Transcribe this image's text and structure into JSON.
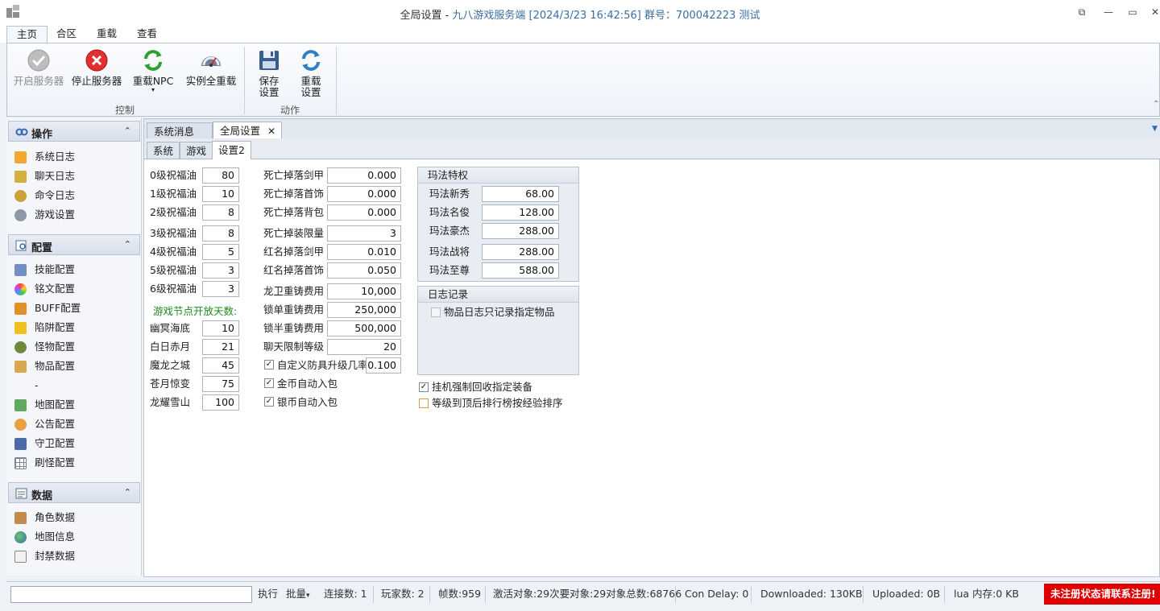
{
  "window": {
    "title_main": "全局设置 - ",
    "title_blue": "九八游戏服务端 [2024/3/23 16:42:56] 群号：700042223  测试",
    "restore_glyph": "⧉",
    "minimize_glyph": "—",
    "maximize_glyph": "▭",
    "close_glyph": "✕"
  },
  "ribbon": {
    "tabs": [
      "主页",
      "合区",
      "重载",
      "查看"
    ],
    "buttons": {
      "start_server": "开启服务器",
      "stop_server": "停止服务器",
      "reload_npc": "重载NPC",
      "reload_npc_arrow": "▾",
      "instance_reload": "实例全重载",
      "save_settings_1": "保存",
      "save_settings_2": "设置",
      "reload_settings_1": "重载",
      "reload_settings_2": "设置"
    },
    "groups": {
      "control": "控制",
      "action": "动作"
    },
    "collapse_glyph": "⌃"
  },
  "sidebar": {
    "sections": [
      {
        "title": "操作",
        "items": [
          "系统日志",
          "聊天日志",
          "命令日志",
          "游戏设置"
        ]
      },
      {
        "title": "配置",
        "items": [
          "技能配置",
          "铭文配置",
          "BUFF配置",
          "陷阱配置",
          "怪物配置",
          "物品配置",
          "-",
          "地图配置",
          "公告配置",
          "守卫配置",
          "刷怪配置"
        ]
      },
      {
        "title": "数据",
        "items": [
          "角色数据",
          "地图信息",
          "封禁数据"
        ]
      }
    ],
    "chevron_glyph": "⌃"
  },
  "doc_tabs": {
    "tab1": "系统消息",
    "tab2": "全局设置",
    "close_glyph": "✕",
    "dropdown_glyph": "▼"
  },
  "sub_tabs": [
    "系统",
    "游戏",
    "设置2"
  ],
  "form": {
    "col1": [
      {
        "label": "0级祝福油",
        "value": "80"
      },
      {
        "label": "1级祝福油",
        "value": "10"
      },
      {
        "label": "2级祝福油",
        "value": "8"
      },
      {
        "label": "3级祝福油",
        "value": "8"
      },
      {
        "label": "4级祝福油",
        "value": "5"
      },
      {
        "label": "5级祝福油",
        "value": "3"
      },
      {
        "label": "6级祝福油",
        "value": "3"
      }
    ],
    "node_days_label": "游戏节点开放天数:",
    "col1b": [
      {
        "label": "幽冥海底",
        "value": "10"
      },
      {
        "label": "白日赤月",
        "value": "21"
      },
      {
        "label": "魔龙之城",
        "value": "45"
      },
      {
        "label": "苍月惊变",
        "value": "75"
      },
      {
        "label": "龙耀雪山",
        "value": "100"
      }
    ],
    "col2": [
      {
        "label": "死亡掉落剑甲",
        "value": "0.000"
      },
      {
        "label": "死亡掉落首饰",
        "value": "0.000"
      },
      {
        "label": "死亡掉落背包",
        "value": "0.000"
      },
      {
        "label": "死亡掉装限量",
        "value": "3"
      },
      {
        "label": "红名掉落剑甲",
        "value": "0.010"
      },
      {
        "label": "红名掉落首饰",
        "value": "0.050"
      },
      {
        "label": "龙卫重铸费用",
        "value": "10,000"
      },
      {
        "label": "锁单重铸费用",
        "value": "250,000"
      },
      {
        "label": "锁半重铸费用",
        "value": "500,000"
      },
      {
        "label": "聊天限制等级",
        "value": "20"
      }
    ],
    "custom_armor_label": "自定义防具升级几率",
    "custom_armor_value": "0.100",
    "gold_auto_label": "金币自动入包",
    "silver_auto_label": "银币自动入包",
    "check_glyph": "✓",
    "mafa": {
      "title": "玛法特权",
      "rows": [
        {
          "label": "玛法新秀",
          "value": "68.00"
        },
        {
          "label": "玛法名俊",
          "value": "128.00"
        },
        {
          "label": "玛法豪杰",
          "value": "288.00"
        },
        {
          "label": "玛法战将",
          "value": "288.00"
        },
        {
          "label": "玛法至尊",
          "value": "588.00"
        }
      ]
    },
    "log": {
      "title": "日志记录",
      "item_log_label": "物品日志只记录指定物品"
    },
    "afk_recycle_label": "挂机强制回收指定装备",
    "level_rank_label": "等级到顶后排行榜按经验排序"
  },
  "statusbar": {
    "execute": "执行",
    "batch": "批量",
    "batch_arrow": "▾",
    "connections": "连接数: 1",
    "players": "玩家数: 2",
    "fps": "帧数:959",
    "objects": "激活对象:29次要对象:29对象总数:68766",
    "con_delay": "Con Delay: 0",
    "downloaded": "Downloaded: 130KB",
    "uploaded": "Uploaded: 0B",
    "lua_mem": "lua 内存:0 KB",
    "warning": "未注册状态请联系注册!"
  }
}
